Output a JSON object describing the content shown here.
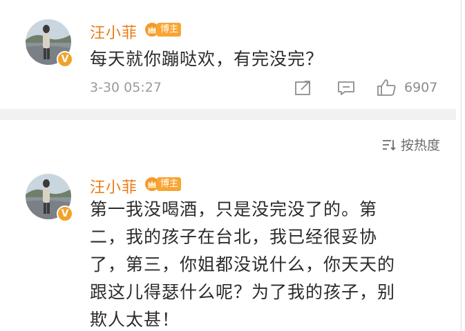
{
  "post1": {
    "username": "汪小菲",
    "badge": "博主",
    "verified_mark": "V",
    "text": "每天就你蹦哒欢，有完没完？",
    "timestamp": "3-30 05:27",
    "like_count": "6907",
    "icons": [
      "share-icon",
      "comment-icon",
      "like-icon"
    ]
  },
  "sort": {
    "label": "按热度",
    "icon": "sort-lines-icon"
  },
  "post2": {
    "username": "汪小菲",
    "badge": "博主",
    "verified_mark": "V",
    "lines": [
      "第一我没喝酒，只是没完没了的。第",
      "二，我的孩子在台北，我已经很妥协",
      "了，第三，你姐都没说什么，你天天的",
      "跟这儿得瑟什么呢？为了我的孩子，别",
      "欺人太甚！"
    ]
  },
  "colors": {
    "username": "#ea7a14",
    "badge_bg": "#f7a534",
    "verified": "#f0a22a",
    "text": "#2b2b2b",
    "meta": "#9a9a9a",
    "divider": "#f1f1f1"
  }
}
